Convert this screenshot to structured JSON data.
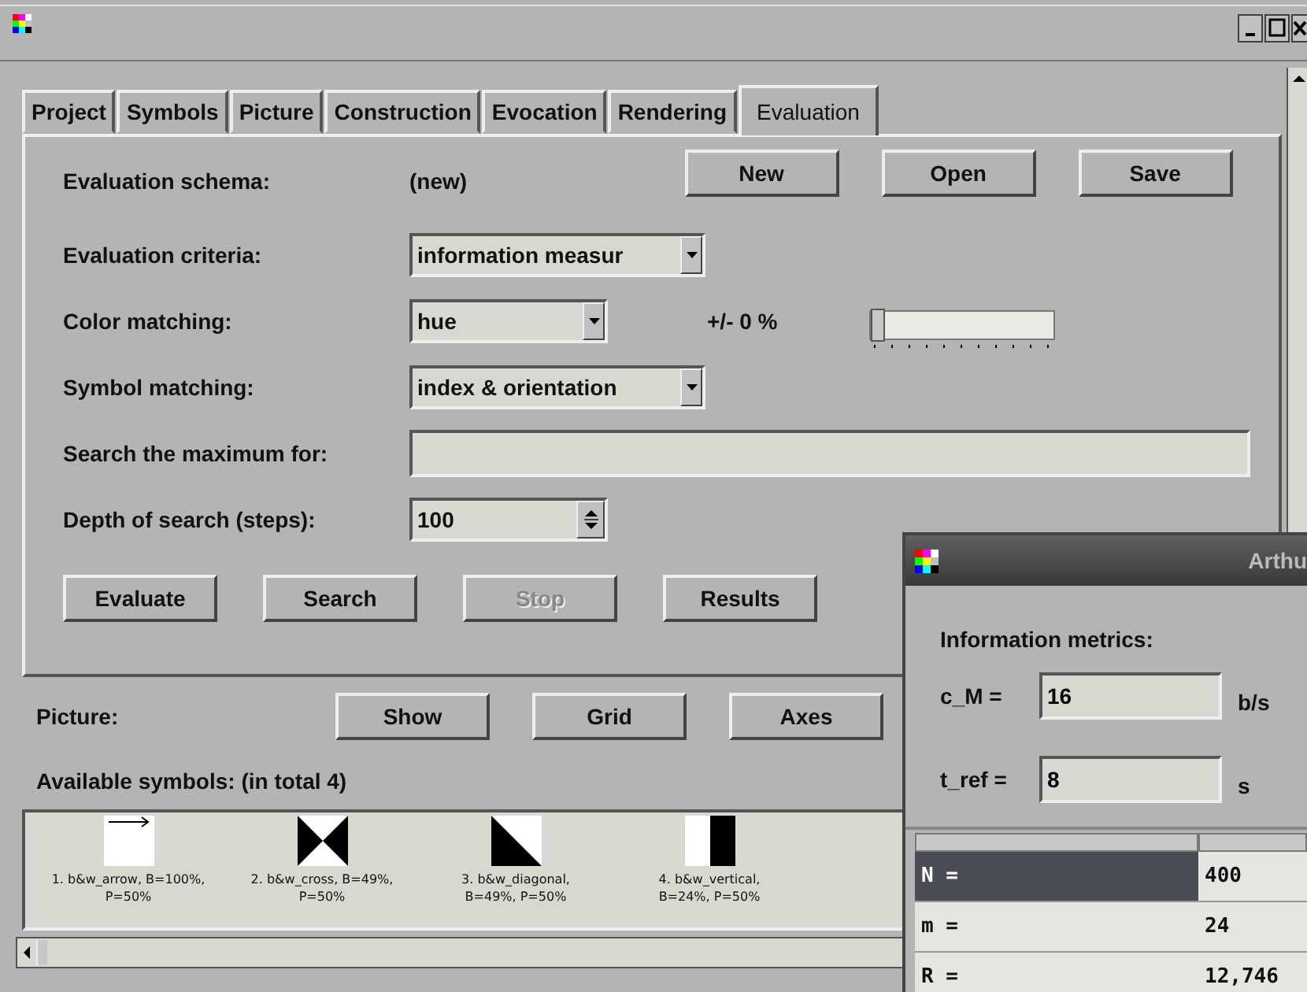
{
  "tabs": [
    {
      "label": "Project",
      "selected": false
    },
    {
      "label": "Symbols",
      "selected": false
    },
    {
      "label": "Picture",
      "selected": false
    },
    {
      "label": "Construction",
      "selected": false
    },
    {
      "label": "Evocation",
      "selected": false
    },
    {
      "label": "Rendering",
      "selected": false
    },
    {
      "label": "Evaluation",
      "selected": true
    }
  ],
  "evaluation": {
    "schema_label": "Evaluation schema:",
    "schema_value": "(new)",
    "schema_buttons": [
      {
        "label": "New",
        "disabled": false
      },
      {
        "label": "Open",
        "disabled": false
      },
      {
        "label": "Save",
        "disabled": false
      }
    ],
    "criteria_label": "Evaluation criteria:",
    "criteria_value": "information measur",
    "color_label": "Color matching:",
    "color_value": "hue",
    "tolerance": "+/- 0 %",
    "tolerance_slider": {
      "level": 0
    },
    "symbol_label": "Symbol matching:",
    "symbol_value": "index & orientation",
    "search_label": "Search the maximum for:",
    "depth_label": "Depth of search (steps):",
    "depth_value": "100",
    "actions": [
      {
        "label": "Evaluate",
        "disabled": false
      },
      {
        "label": "Search",
        "disabled": false
      },
      {
        "label": "Stop",
        "disabled": true
      },
      {
        "label": "Results",
        "disabled": false
      }
    ]
  },
  "picture": {
    "label": "Picture:",
    "buttons": [
      {
        "label": "Show",
        "disabled": false
      },
      {
        "label": "Grid",
        "disabled": false
      },
      {
        "label": "Axes",
        "disabled": false
      }
    ]
  },
  "symbols": {
    "heading": "Available symbols: (in total 4)",
    "items": [
      {
        "kind": "arrow",
        "lines": [
          "1. b&w_arrow, B=100%,",
          "P=50%"
        ]
      },
      {
        "kind": "cross",
        "lines": [
          "2. b&w_cross, B=49%,",
          "P=50%"
        ]
      },
      {
        "kind": "diagonal",
        "lines": [
          "3. b&w_diagonal,",
          "B=49%, P=50%"
        ]
      },
      {
        "kind": "vertical",
        "lines": [
          "4. b&w_vertical,",
          "B=24%, P=50%"
        ]
      }
    ]
  },
  "metrics_window": {
    "title": "Arthu",
    "heading": "Information metrics:",
    "fields": [
      {
        "label": "c_M =",
        "value": "16",
        "unit": "b/s"
      },
      {
        "label": "t_ref =",
        "value": "8",
        "unit": "s"
      }
    ],
    "table": {
      "rows": [
        {
          "name": "N  =",
          "value": "400",
          "selected": true
        },
        {
          "name": "m  =",
          "value": "24",
          "selected": false
        },
        {
          "name": "R  =",
          "value": "12,746",
          "selected": false
        }
      ]
    }
  }
}
